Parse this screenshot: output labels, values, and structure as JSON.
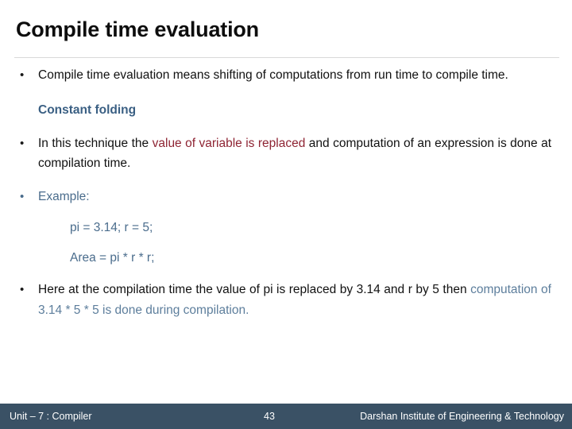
{
  "slide": {
    "title": "Compile time evaluation",
    "page_number": "43"
  },
  "content": {
    "bullet1": {
      "marker": "•",
      "text": "Compile time evaluation means shifting of computations from run time to compile time."
    },
    "subheading": "Constant folding",
    "bullet2": {
      "marker": "•",
      "part1": "In this technique the ",
      "highlight": "value of variable is replaced",
      "part2": " and computation of an expression is done at compilation time."
    },
    "bullet3": {
      "marker": "•",
      "label": "Example:"
    },
    "code": {
      "line1": "pi = 3.14; r = 5;",
      "line2": "Area = pi * r * r;"
    },
    "bullet4": {
      "marker": "•",
      "part1": "Here at the compilation time the value of pi is replaced by 3.14 and r by 5 then ",
      "highlight": "computation of 3.14 * 5 * 5 is done during compilation."
    }
  },
  "footer": {
    "left": "Unit – 7 : Compiler",
    "center": "43",
    "right": "Darshan Institute of Engineering & Technology"
  },
  "colors": {
    "title": "#0d0d0d",
    "accent_blue": "#3a5f83",
    "soft_blue": "#5d7e9c",
    "accent_red": "#8e2433",
    "footer_bar": "#3a5165",
    "rule": "#d9d9d9"
  }
}
